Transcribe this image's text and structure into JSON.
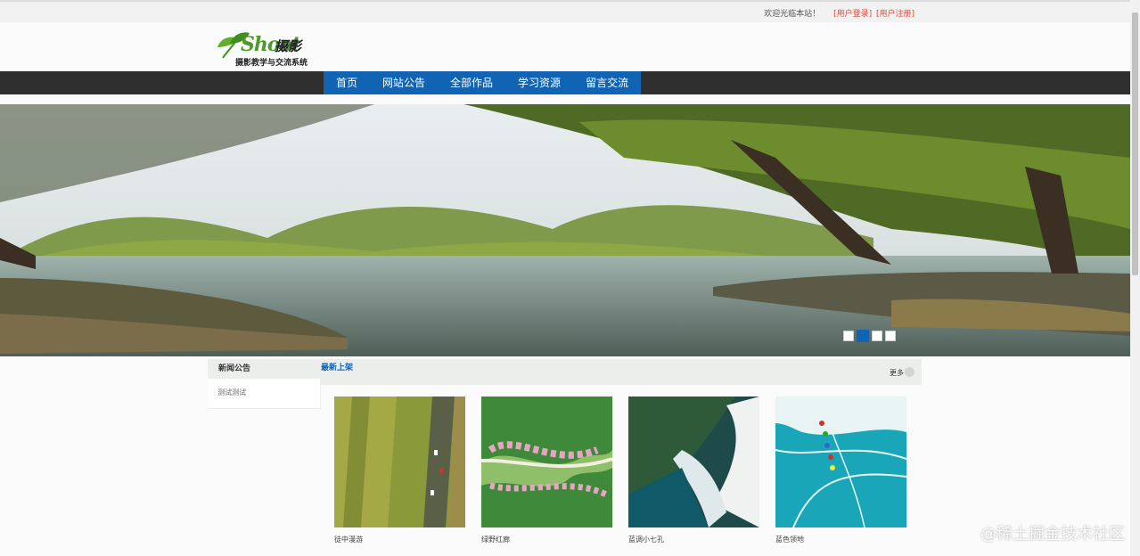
{
  "topbar": {
    "welcome": "欢迎光临本站！",
    "login": "[用户登录]",
    "register": "[用户注册]"
  },
  "logo": {
    "script": "Shoot",
    "cn": "摄影",
    "subtitle": "摄影教学与交流系统"
  },
  "nav": {
    "items": [
      "首页",
      "网站公告",
      "全部作品",
      "学习资源",
      "留言交流"
    ]
  },
  "banner": {
    "slides": 4,
    "active_slide": 2
  },
  "notice": {
    "title": "新闻公告",
    "items": [
      "测试测试"
    ]
  },
  "latest": {
    "title": "最新上架",
    "more": "更多"
  },
  "cards": [
    {
      "caption": "徒中漫游"
    },
    {
      "caption": "绿野红廊"
    },
    {
      "caption": "蓝调小七孔"
    },
    {
      "caption": "蓝色领地"
    }
  ],
  "watermark": "@稀土掘金技术社区",
  "colors": {
    "nav_bg": "#2f2f2f",
    "nav_active": "#1164b4",
    "link_red": "#e0483c"
  }
}
